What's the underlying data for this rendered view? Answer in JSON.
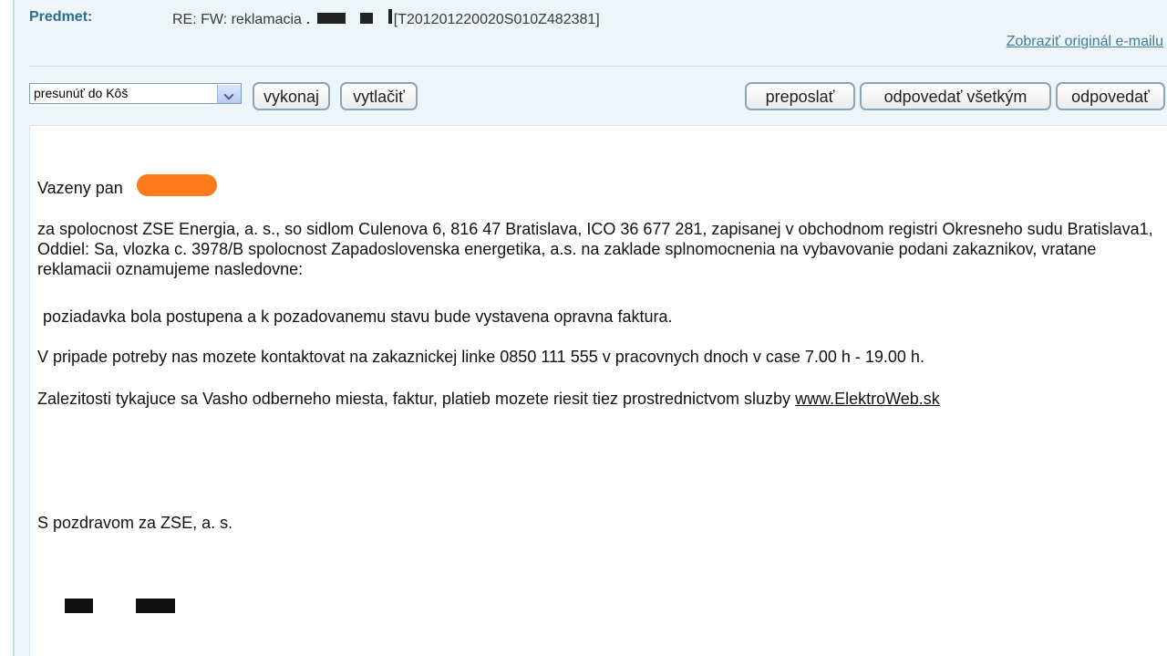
{
  "header": {
    "subject_label": "Predmet:",
    "subject_value_prefix": "RE: FW: reklamacia",
    "subject_value_suffix": "[T201201220020S010Z482381]",
    "original_email_link": "Zobraziť originál e-mailu"
  },
  "toolbar": {
    "folder_select_value": "presunúť do Kôš",
    "execute_label": "vykonaj",
    "print_label": "vytlačiť",
    "forward_label": "preposlať",
    "reply_all_label": "odpovedať všetkým",
    "reply_label": "odpovedať"
  },
  "message": {
    "greeting": "Vazeny pan",
    "paragraph_1": "za spolocnost ZSE Energia, a. s., so sidlom Culenova 6, 816 47 Bratislava, ICO 36 677 281, zapisanej v obchodnom registri Okresneho sudu Bratislava1, Oddiel: Sa, vlozka c. 3978/B spolocnost Zapadoslovenska energetika, a.s. na zaklade splnomocnenia na vybavovanie podani zakaznikov, vratane reklamacii oznamujeme nasledovne:",
    "paragraph_2": "poziadavka bola postupena a k pozadovanemu stavu bude vystavena opravna faktura.",
    "paragraph_3": "V pripade potreby nas mozete kontaktovat na zakaznickej linke 0850 111 555 v pracovnych dnoch v case 7.00 h - 19.00 h.",
    "paragraph_4_prefix": "Zalezitosti tykajuce sa Vasho odberneho miesta, faktur, platieb mozete riesit tiez prostrednictvom sluzby",
    "paragraph_4_link": "www.ElektroWeb.sk",
    "closing": "S pozdravom za ZSE, a. s."
  },
  "colors": {
    "subject_label": "#2a6f8d",
    "panel_background": "#edf5f8",
    "redaction_orange": "#ff7a1a",
    "redaction_black": "#111111"
  }
}
